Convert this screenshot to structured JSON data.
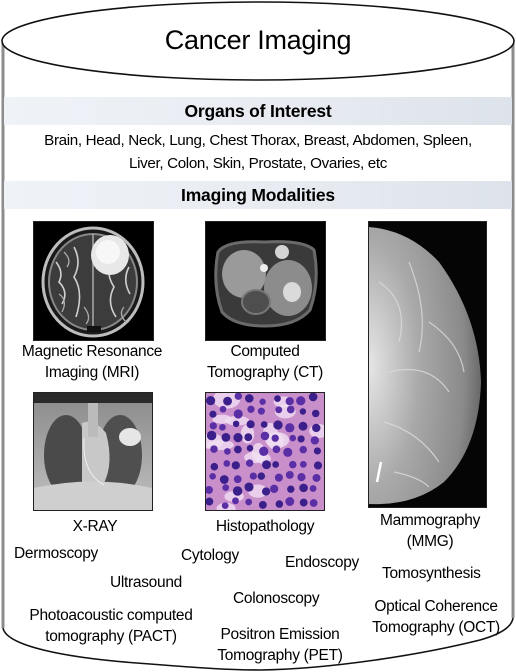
{
  "title": "Cancer Imaging",
  "sections": {
    "organs": {
      "heading": "Organs of Interest",
      "line1": "Brain, Head, Neck, Lung, Chest Thorax, Breast, Abdomen, Spleen,",
      "line2": "Liver, Colon, Skin, Prostate, Ovaries, etc"
    },
    "modalities": {
      "heading": "Imaging Modalities"
    }
  },
  "images": {
    "mri": {
      "label1": "Magnetic Resonance",
      "label2": "Imaging (MRI)"
    },
    "ct": {
      "label1": "Computed",
      "label2": "Tomography (CT)"
    },
    "xray": {
      "label1": "X-RAY"
    },
    "histo": {
      "label1": "Histopathology"
    },
    "mmg": {
      "label1": "Mammography",
      "label2": "(MMG)"
    }
  },
  "other_modalities": {
    "dermoscopy": "Dermoscopy",
    "cytology": "Cytology",
    "endoscopy": "Endoscopy",
    "tomosynthesis": "Tomosynthesis",
    "ultrasound": "Ultrasound",
    "colonoscopy": "Colonoscopy",
    "pact1": "Photoacoustic computed",
    "pact2": "tomography (PACT)",
    "pet1": "Positron Emission",
    "pet2": "Tomography (PET)",
    "oct1": "Optical Coherence",
    "oct2": "Tomography (OCT)"
  },
  "colors": {
    "band_light": "#eff2f7",
    "band_dark": "#dde3ea",
    "cylinder_side": "#8c8c8c",
    "outline": "#111111"
  }
}
